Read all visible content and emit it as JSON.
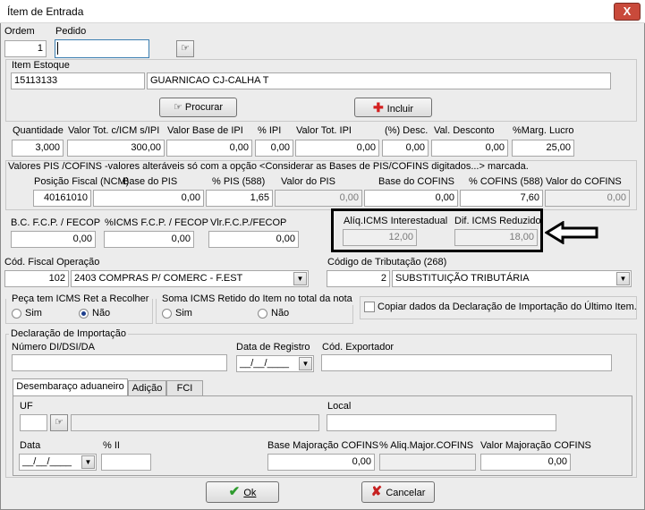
{
  "window": {
    "title": "Ítem de Entrada",
    "close_glyph": "X"
  },
  "header": {
    "ordem_label": "Ordem",
    "ordem_value": "1",
    "pedido_label": "Pedido",
    "pedido_value": ""
  },
  "item_estoque": {
    "label": "Item Estoque",
    "code": "15113133",
    "description": "GUARNICAO CJ-CALHA T",
    "procurar_label": "Procurar",
    "incluir_label": "Incluir"
  },
  "valores": {
    "labels": [
      "Quantidade",
      "Valor Tot. c/ICM s/IPI",
      "Valor Base de IPI",
      "% IPI",
      "Valor Tot. IPI",
      "(%) Desc.",
      "Val. Desconto",
      "%Marg. Lucro"
    ],
    "values": [
      "3,000",
      "300,00",
      "0,00",
      "0,00",
      "0,00",
      "0,00",
      "0,00",
      "25,00"
    ]
  },
  "pis_cofins": {
    "caption": "Valores PIS /COFINS -valores alteráveis só com a opção <Considerar as Bases de PIS/COFINS digitados...> marcada.",
    "labels": [
      "Posição Fiscal (NCM)",
      "Base do PIS",
      "% PIS (588)",
      "Valor do PIS",
      "Base do COFINS",
      "% COFINS (588)",
      "Valor do COFINS"
    ],
    "values": [
      "40161010",
      "0,00",
      "1,65",
      "0,00",
      "0,00",
      "7,60",
      "0,00"
    ]
  },
  "fcp": {
    "labels": [
      "B.C. F.C.P. / FECOP",
      "%ICMS F.C.P. / FECOP",
      "Vlr.F.C.P./FECOP"
    ],
    "values": [
      "0,00",
      "0,00",
      "0,00"
    ]
  },
  "icms_inter": {
    "aliq_label": "Alíq.ICMS Interestadual",
    "aliq_value": "12,00",
    "dif_label": "Dif. ICMS Reduzido",
    "dif_value": "18,00"
  },
  "fiscal": {
    "cfop_label": "Cód. Fiscal Operação",
    "cfop_code": "102",
    "cfop_desc": "2403 COMPRAS P/ COMERC - F.EST",
    "trib_label": "Código de Tributação (268)",
    "trib_code": "2",
    "trib_desc": "SUBSTITUIÇÃO TRIBUTÁRIA"
  },
  "icms_ret": {
    "label": "Peça tem ICMS Ret a Recolher",
    "opt_sim": "Sim",
    "opt_nao": "Não",
    "selected": "Não"
  },
  "soma_icms": {
    "label": "Soma ICMS Retido do Item no total da nota",
    "opt_sim": "Sim",
    "opt_nao": "Não",
    "selected": "none"
  },
  "copiar": {
    "label": "Copiar dados da Declaração de Importação do Último Item."
  },
  "declaracao": {
    "label": "Declaração de Importação",
    "numero_label": "Número DI/DSI/DA",
    "numero_value": "",
    "data_registro_label": "Data de Registro",
    "data_registro_value": "__/__/____",
    "exportador_label": "Cód. Exportador",
    "exportador_value": ""
  },
  "tabs": [
    {
      "label": "Desembaraço aduaneiro"
    },
    {
      "label": "Adição"
    },
    {
      "label": "FCI"
    }
  ],
  "desembaraco": {
    "uf_label": "UF",
    "uf_value": "",
    "local_label": "Local",
    "local_value": "",
    "data_label": "Data",
    "data_value": "__/__/____",
    "ii_label": "% II",
    "ii_value": "",
    "base_label": "Base Majoração COFINS",
    "base_value": "0,00",
    "aliq_label": "% Aliq.Major.COFINS",
    "aliq_value": "",
    "valor_label": "Valor Majoração COFINS",
    "valor_value": "0,00"
  },
  "footer": {
    "ok_label": "Ok",
    "cancelar_label": "Cancelar"
  },
  "colors": {
    "highlight_border": "#000000",
    "ok_icon": "#2e9b2e",
    "cancel_icon": "#c62020",
    "incluir_icon": "#d42020"
  }
}
